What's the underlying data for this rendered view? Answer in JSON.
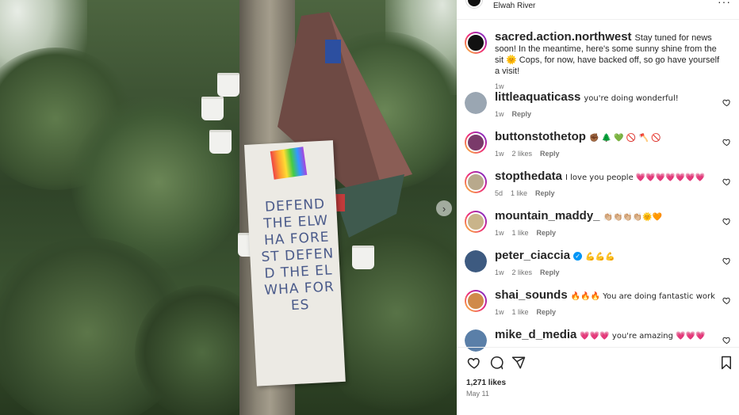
{
  "post": {
    "location": "Elwah River",
    "more_icon": "more-horizontal-icon",
    "caption": {
      "username": "sacred.action.northwest",
      "text": "Stay tuned for news soon! In the meantime, here's some sunny shine from the sit 🌞 Cops, for now, have backed off, so go have yourself a visit!",
      "time": "1w"
    },
    "banner_text": "DEFEND THE ELWHA FOREST DEFEND THE ELWHA FORES",
    "likes": "1,271 likes",
    "date": "May 11"
  },
  "comments": [
    {
      "username": "littleaquaticass",
      "text": "you're doing wonderful!",
      "time": "1w",
      "likes": "",
      "reply": "Reply",
      "avatar_color": "#9aa6b2",
      "ring": false
    },
    {
      "username": "buttonstothetop",
      "text": "✊🏾 🌲 💚 🚫 🪓 🚫",
      "time": "1w",
      "likes": "2 likes",
      "reply": "Reply",
      "avatar_color": "#7a3a6a",
      "ring": true
    },
    {
      "username": "stopthedata",
      "text": "I love you people 💗💗💗💗💗💗💗",
      "time": "5d",
      "likes": "1 like",
      "reply": "Reply",
      "avatar_color": "#b8a98c",
      "ring": true
    },
    {
      "username": "mountain_maddy_",
      "text": "👏🏼👏🏼👏🏼👏🏼🌞🧡",
      "time": "1w",
      "likes": "1 like",
      "reply": "Reply",
      "avatar_color": "#c9b48a",
      "ring": true
    },
    {
      "username": "peter_ciaccia",
      "text": "💪💪💪",
      "time": "1w",
      "likes": "2 likes",
      "reply": "Reply",
      "avatar_color": "#3d5a80",
      "ring": false,
      "verified": true
    },
    {
      "username": "shai_sounds",
      "text": "🔥🔥🔥 You are doing fantastic work",
      "time": "1w",
      "likes": "1 like",
      "reply": "Reply",
      "avatar_color": "#d08a4a",
      "ring": true
    },
    {
      "username": "mike_d_media",
      "text": "💗💗💗 you're amazing 💗💗💗",
      "time": "",
      "likes": "",
      "reply": "",
      "avatar_color": "#5a7fa8",
      "ring": false
    }
  ],
  "icons": {
    "like": "heart-icon",
    "comment": "comment-icon",
    "share": "share-icon",
    "save": "bookmark-icon",
    "next": "chevron-right-icon"
  }
}
